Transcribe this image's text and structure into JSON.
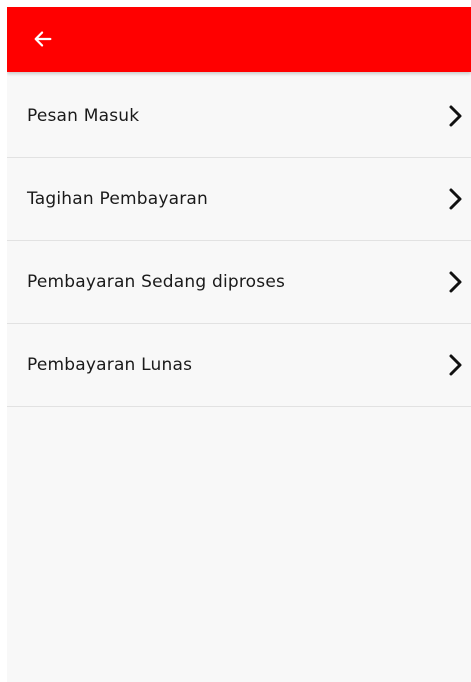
{
  "app_bar": {
    "background": "#ff0000",
    "back_icon": "arrow-left-icon"
  },
  "menu": {
    "items": [
      {
        "label": "Pesan Masuk",
        "icon": "chevron-right-icon"
      },
      {
        "label": "Tagihan Pembayaran",
        "icon": "chevron-right-icon"
      },
      {
        "label": "Pembayaran Sedang diproses",
        "icon": "chevron-right-icon"
      },
      {
        "label": "Pembayaran Lunas",
        "icon": "chevron-right-icon"
      }
    ]
  },
  "colors": {
    "accent": "#ff0000",
    "surface": "#f8f8f8",
    "divider": "#e2e2e2",
    "text": "#1a1a1a"
  }
}
